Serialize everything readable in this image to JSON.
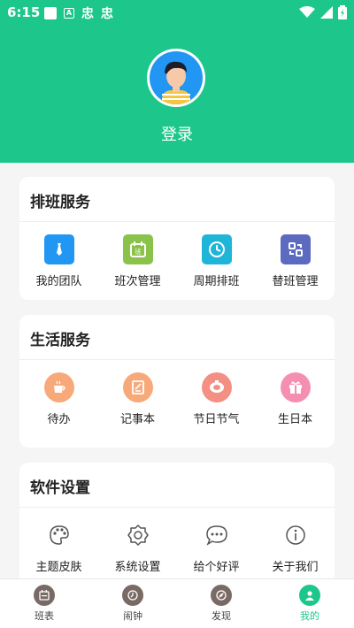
{
  "status_bar": {
    "time": "6:15",
    "notif_glyph_1": "忠",
    "notif_glyph_2": "忠"
  },
  "profile": {
    "login_label": "登录"
  },
  "sections": [
    {
      "title": "排班服务",
      "items": [
        {
          "label": "我的团队",
          "icon": "tie-icon",
          "color": "#2196f3"
        },
        {
          "label": "班次管理",
          "icon": "calendar-icon",
          "color": "#8bc34a"
        },
        {
          "label": "周期排班",
          "icon": "clock-icon",
          "color": "#1fb5d8"
        },
        {
          "label": "替班管理",
          "icon": "swap-icon",
          "color": "#5c6bc0"
        }
      ]
    },
    {
      "title": "生活服务",
      "items": [
        {
          "label": "待办",
          "icon": "cup-icon",
          "color": "#f7a97a"
        },
        {
          "label": "记事本",
          "icon": "notebook-icon",
          "color": "#f7a97a"
        },
        {
          "label": "节日节气",
          "icon": "festival-icon",
          "color": "#f48f84"
        },
        {
          "label": "生日本",
          "icon": "gift-icon",
          "color": "#f48fb1"
        }
      ]
    },
    {
      "title": "软件设置",
      "items": [
        {
          "label": "主题皮肤",
          "icon": "palette-icon"
        },
        {
          "label": "系统设置",
          "icon": "settings-icon"
        },
        {
          "label": "给个好评",
          "icon": "comment-icon"
        },
        {
          "label": "关于我们",
          "icon": "info-icon"
        }
      ]
    }
  ],
  "bottom_nav": [
    {
      "label": "班表",
      "icon": "schedule-icon"
    },
    {
      "label": "闹钟",
      "icon": "alarm-icon"
    },
    {
      "label": "发现",
      "icon": "discover-icon"
    },
    {
      "label": "我的",
      "icon": "profile-icon",
      "active": true
    }
  ],
  "colors": {
    "brand": "#1dc78c",
    "nav_inactive": "#7a6a66"
  }
}
